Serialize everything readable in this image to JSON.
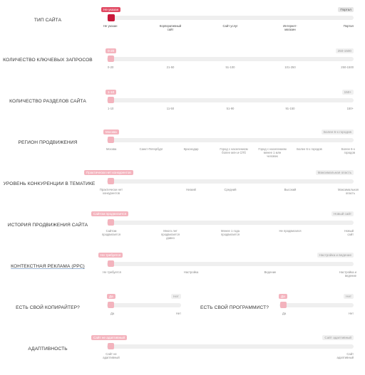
{
  "rows": [
    {
      "label": "Тип сайта",
      "tag": "Не указан",
      "max": "Портал",
      "ticks": [
        "Не указан",
        "Корпоративный сайт",
        "Сайт услуг",
        "Интернет-магазин",
        "Портал"
      ]
    },
    {
      "label": "Количество ключевых запросов",
      "tag": "0-20",
      "max": "250-1500",
      "ticks": [
        "0-20",
        "21-50",
        "51-100",
        "101-250",
        "250-1500"
      ]
    },
    {
      "label": "Количество разделов сайта",
      "tag": "1-10",
      "max": "150+",
      "ticks": [
        "1-10",
        "11-50",
        "51-90",
        "91-150",
        "150+"
      ]
    },
    {
      "label": "Регион продвижения",
      "tag": "Москва",
      "max": "Более 6-х городов",
      "ticks": [
        "Москва",
        "Санкт-Петербург",
        "Краснодар",
        "Город с населением более млн и СПб",
        "Город с населением менее 1 млн человек",
        "Более 6-х городов",
        "Более 6-х городов"
      ]
    },
    {
      "label": "Уровень конкуренции в тематике",
      "tag": "Практически нет конкурентов",
      "max": "Максимальная опасть",
      "ticks": [
        "Практически нет конкурентов",
        "Низкий",
        "Средний",
        "Высокий",
        "Максимальная опасть"
      ]
    },
    {
      "label": "История продвижения сайта",
      "tag": "Сайтом продвигается",
      "max": "Новый сайт",
      "ticks": [
        "Сайтом продвигается",
        "Много лет продвигается давно",
        "Менее 1 года продвигается",
        "Не продвигался",
        "Новый сайт"
      ]
    },
    {
      "label": "Контекстная реклама (PPC)",
      "tag": "Не требуется",
      "max": "Настройка и ведение",
      "ticks": [
        "Не требуется",
        "Настройка",
        "Ведение",
        "Настройка и ведение"
      ]
    },
    {
      "label": "Адаптивность",
      "tag": "Сайт не адаптивный",
      "max": "Сайт адаптивный",
      "ticks": [
        "Сайт не адаптивный",
        "Сайт адаптивный"
      ]
    }
  ],
  "pair": [
    {
      "label": "Есть свой копирайтер?",
      "tag": "Да",
      "max": "Нет",
      "ticks": [
        "Да",
        "Нет"
      ]
    },
    {
      "label": "Есть свой программист?",
      "tag": "Да",
      "max": "Нет",
      "ticks": [
        "Да",
        "Нет"
      ]
    }
  ]
}
